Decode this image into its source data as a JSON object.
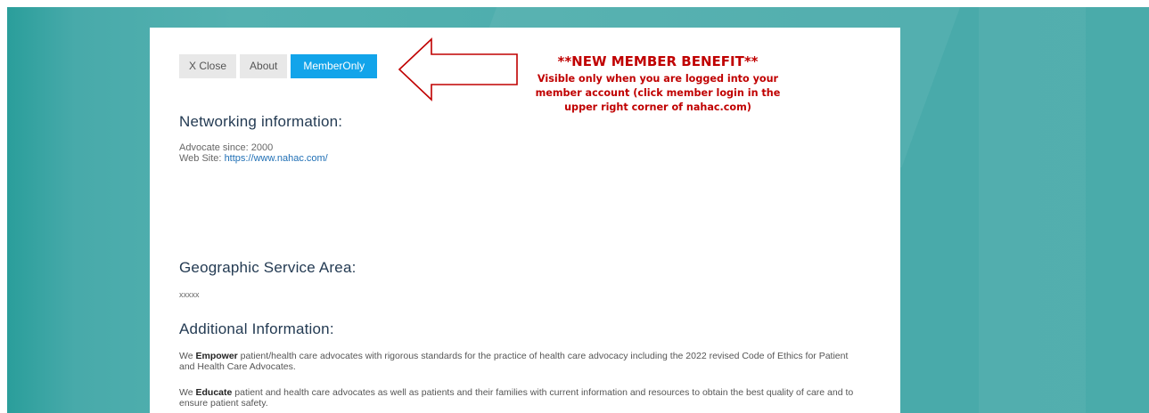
{
  "tabs": {
    "close": "X Close",
    "about": "About",
    "member_only": "MemberOnly"
  },
  "networking": {
    "heading": "Networking information:",
    "advocate_since": "Advocate since: 2000",
    "website_label": "Web Site:",
    "website_url": "https://www.nahac.com/"
  },
  "geographic": {
    "heading": "Geographic Service Area:",
    "value": "xxxxx"
  },
  "additional": {
    "heading": "Additional Information:",
    "p1_lead": "We ",
    "p1_bold": "Empower",
    "p1_rest": " patient/health care advocates with rigorous standards for the practice of health care advocacy including the 2022 revised Code of Ethics for Patient and Health Care Advocates.",
    "p2_lead": "We ",
    "p2_bold": "Educate",
    "p2_rest": " patient and health care advocates as well as patients and their families with current information and resources to obtain the best quality of care and to ensure patient safety."
  },
  "callout": {
    "title": "**NEW MEMBER BENEFIT**",
    "line1": "Visible only when you are logged into your",
    "line2": "member account (click member login in the",
    "line3": "upper right corner of nahac.com)"
  },
  "colors": {
    "background_teal": "#4aabaa",
    "active_tab": "#12a4ea",
    "callout_red": "#c00000",
    "heading_navy": "#243b53"
  },
  "icons": {
    "arrow": "left-arrow-outline-icon"
  }
}
